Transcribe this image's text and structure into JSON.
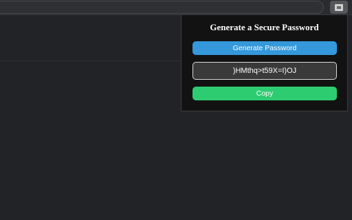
{
  "popup": {
    "title": "Generate a Secure Password",
    "generate_label": "Generate Password",
    "password_value": ")HMthq>t59X=I)OJ",
    "copy_label": "Copy"
  },
  "toolbar": {
    "extension_icon": "extension-icon"
  },
  "colors": {
    "generate_button": "#3498db",
    "copy_button": "#2ecc71",
    "popup_background": "#121212",
    "page_background": "#222326"
  }
}
